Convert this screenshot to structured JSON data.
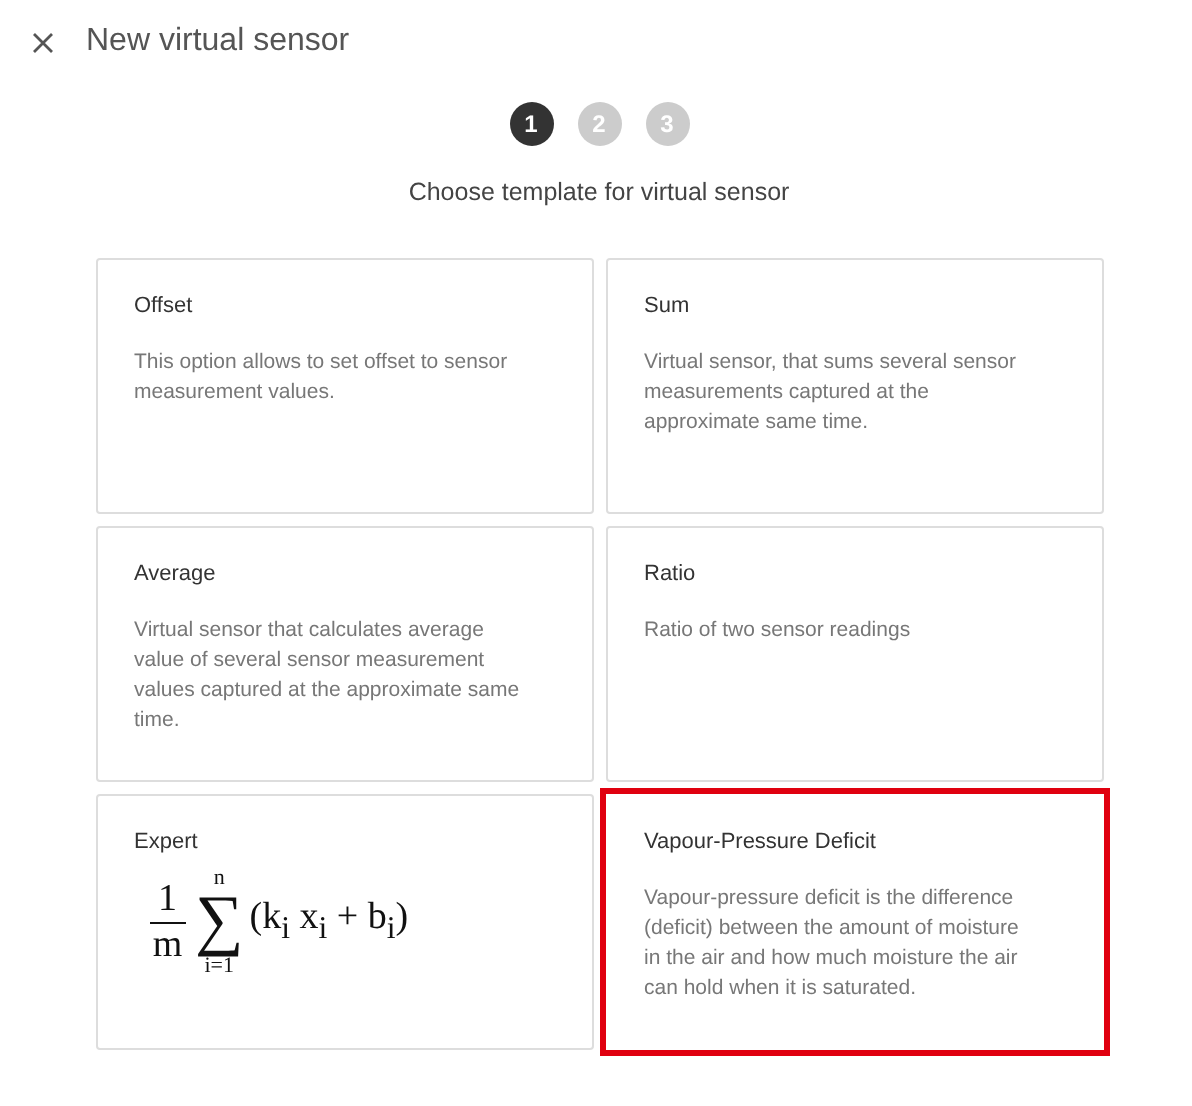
{
  "window": {
    "title": "New virtual sensor"
  },
  "steps": [
    {
      "label": "1",
      "selected": true
    },
    {
      "label": "2",
      "selected": false
    },
    {
      "label": "3",
      "selected": false
    }
  ],
  "subtitle": "Choose template for virtual sensor",
  "templates": [
    {
      "kind": "text",
      "title": "Offset",
      "description": "This option allows to set offset to sensor measurement values.",
      "selected": false
    },
    {
      "kind": "text",
      "title": "Sum",
      "description": "Virtual sensor, that sums several sensor measurements captured at the approximate same time.",
      "selected": false
    },
    {
      "kind": "text",
      "title": "Average",
      "description": "Virtual sensor that calculates average value of several sensor measurement values captured at the approximate same time.",
      "selected": false
    },
    {
      "kind": "text",
      "title": "Ratio",
      "description": "Ratio of two sensor readings",
      "selected": false
    },
    {
      "kind": "formula",
      "title": "Expert",
      "formula": {
        "numerator": "1",
        "denominator": "m",
        "operator": "∑",
        "upper": "n",
        "lower": "i=1",
        "body": "(k$_{i}$ x$_{i}$ + b$_{i}$)"
      },
      "selected": false
    },
    {
      "kind": "text",
      "title": "Vapour-Pressure Deficit",
      "description": "Vapour-pressure deficit is the difference (deficit) between the amount of moisture in the air and how much moisture the air can hold when it is saturated.",
      "selected": true
    }
  ]
}
